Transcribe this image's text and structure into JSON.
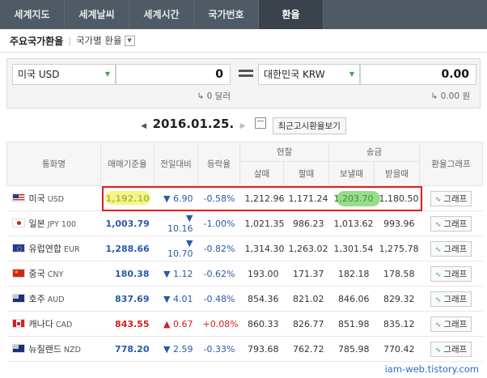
{
  "nav": {
    "tabs": [
      "세계지도",
      "세계날씨",
      "세계시간",
      "국가번호",
      "환율"
    ],
    "active": 4
  },
  "subheader": {
    "title": "주요국가환율",
    "dropdown_label": "국가별 환율"
  },
  "converter": {
    "from_currency": "미국 USD",
    "from_value": "0",
    "from_unit": "↳ 0 달러",
    "to_currency": "대한민국 KRW",
    "to_value": "0.00",
    "to_unit": "↳ 0.00 원"
  },
  "date": {
    "value": "2016.01.25.",
    "recent_button": "최근고시환율보기"
  },
  "table": {
    "headers": {
      "currency": "통화명",
      "standard": "매매기준율",
      "change": "전일대비",
      "rate": "등락율",
      "cash": "현찰",
      "cash_buy": "살때",
      "cash_sell": "팔때",
      "remit": "송금",
      "remit_send": "보낼때",
      "remit_receive": "받을때",
      "graph": "환율그래프"
    },
    "graph_button": "그래프",
    "rows": [
      {
        "name": "미국",
        "code": "USD",
        "std": "1,192.10",
        "dir": "▼",
        "chg": "6.90",
        "pct": "-0.58%",
        "cbuy": "1,212.96",
        "csell": "1,171.24",
        "send": "1,203.70",
        "recv": "1,180.50"
      },
      {
        "name": "일본",
        "code": "JPY 100",
        "std": "1,003.79",
        "dir": "▼",
        "chg": "10.16",
        "pct": "-1.00%",
        "cbuy": "1,021.35",
        "csell": "986.23",
        "send": "1,013.62",
        "recv": "993.96"
      },
      {
        "name": "유럽연합",
        "code": "EUR",
        "std": "1,288.66",
        "dir": "▼",
        "chg": "10.70",
        "pct": "-0.82%",
        "cbuy": "1,314.30",
        "csell": "1,263.02",
        "send": "1,301.54",
        "recv": "1,275.78"
      },
      {
        "name": "중국",
        "code": "CNY",
        "std": "180.38",
        "dir": "▼",
        "chg": "1.12",
        "pct": "-0.62%",
        "cbuy": "193.00",
        "csell": "171.37",
        "send": "182.18",
        "recv": "178.58"
      },
      {
        "name": "호주",
        "code": "AUD",
        "std": "837.69",
        "dir": "▼",
        "chg": "4.01",
        "pct": "-0.48%",
        "cbuy": "854.36",
        "csell": "821.02",
        "send": "846.06",
        "recv": "829.32"
      },
      {
        "name": "캐나다",
        "code": "CAD",
        "std": "843.55",
        "dir": "▲",
        "chg": "0.67",
        "pct": "+0.08%",
        "cbuy": "860.33",
        "csell": "826.77",
        "send": "851.98",
        "recv": "835.12"
      },
      {
        "name": "뉴질랜드",
        "code": "NZD",
        "std": "778.20",
        "dir": "▼",
        "chg": "2.59",
        "pct": "-0.33%",
        "cbuy": "793.68",
        "csell": "762.72",
        "send": "785.98",
        "recv": "770.42"
      }
    ]
  },
  "watermark": "iam-web.tistory.com",
  "colors": {
    "down": "#2a59a8",
    "up": "#d11f1f",
    "highlight_box": "#e51b1b"
  }
}
